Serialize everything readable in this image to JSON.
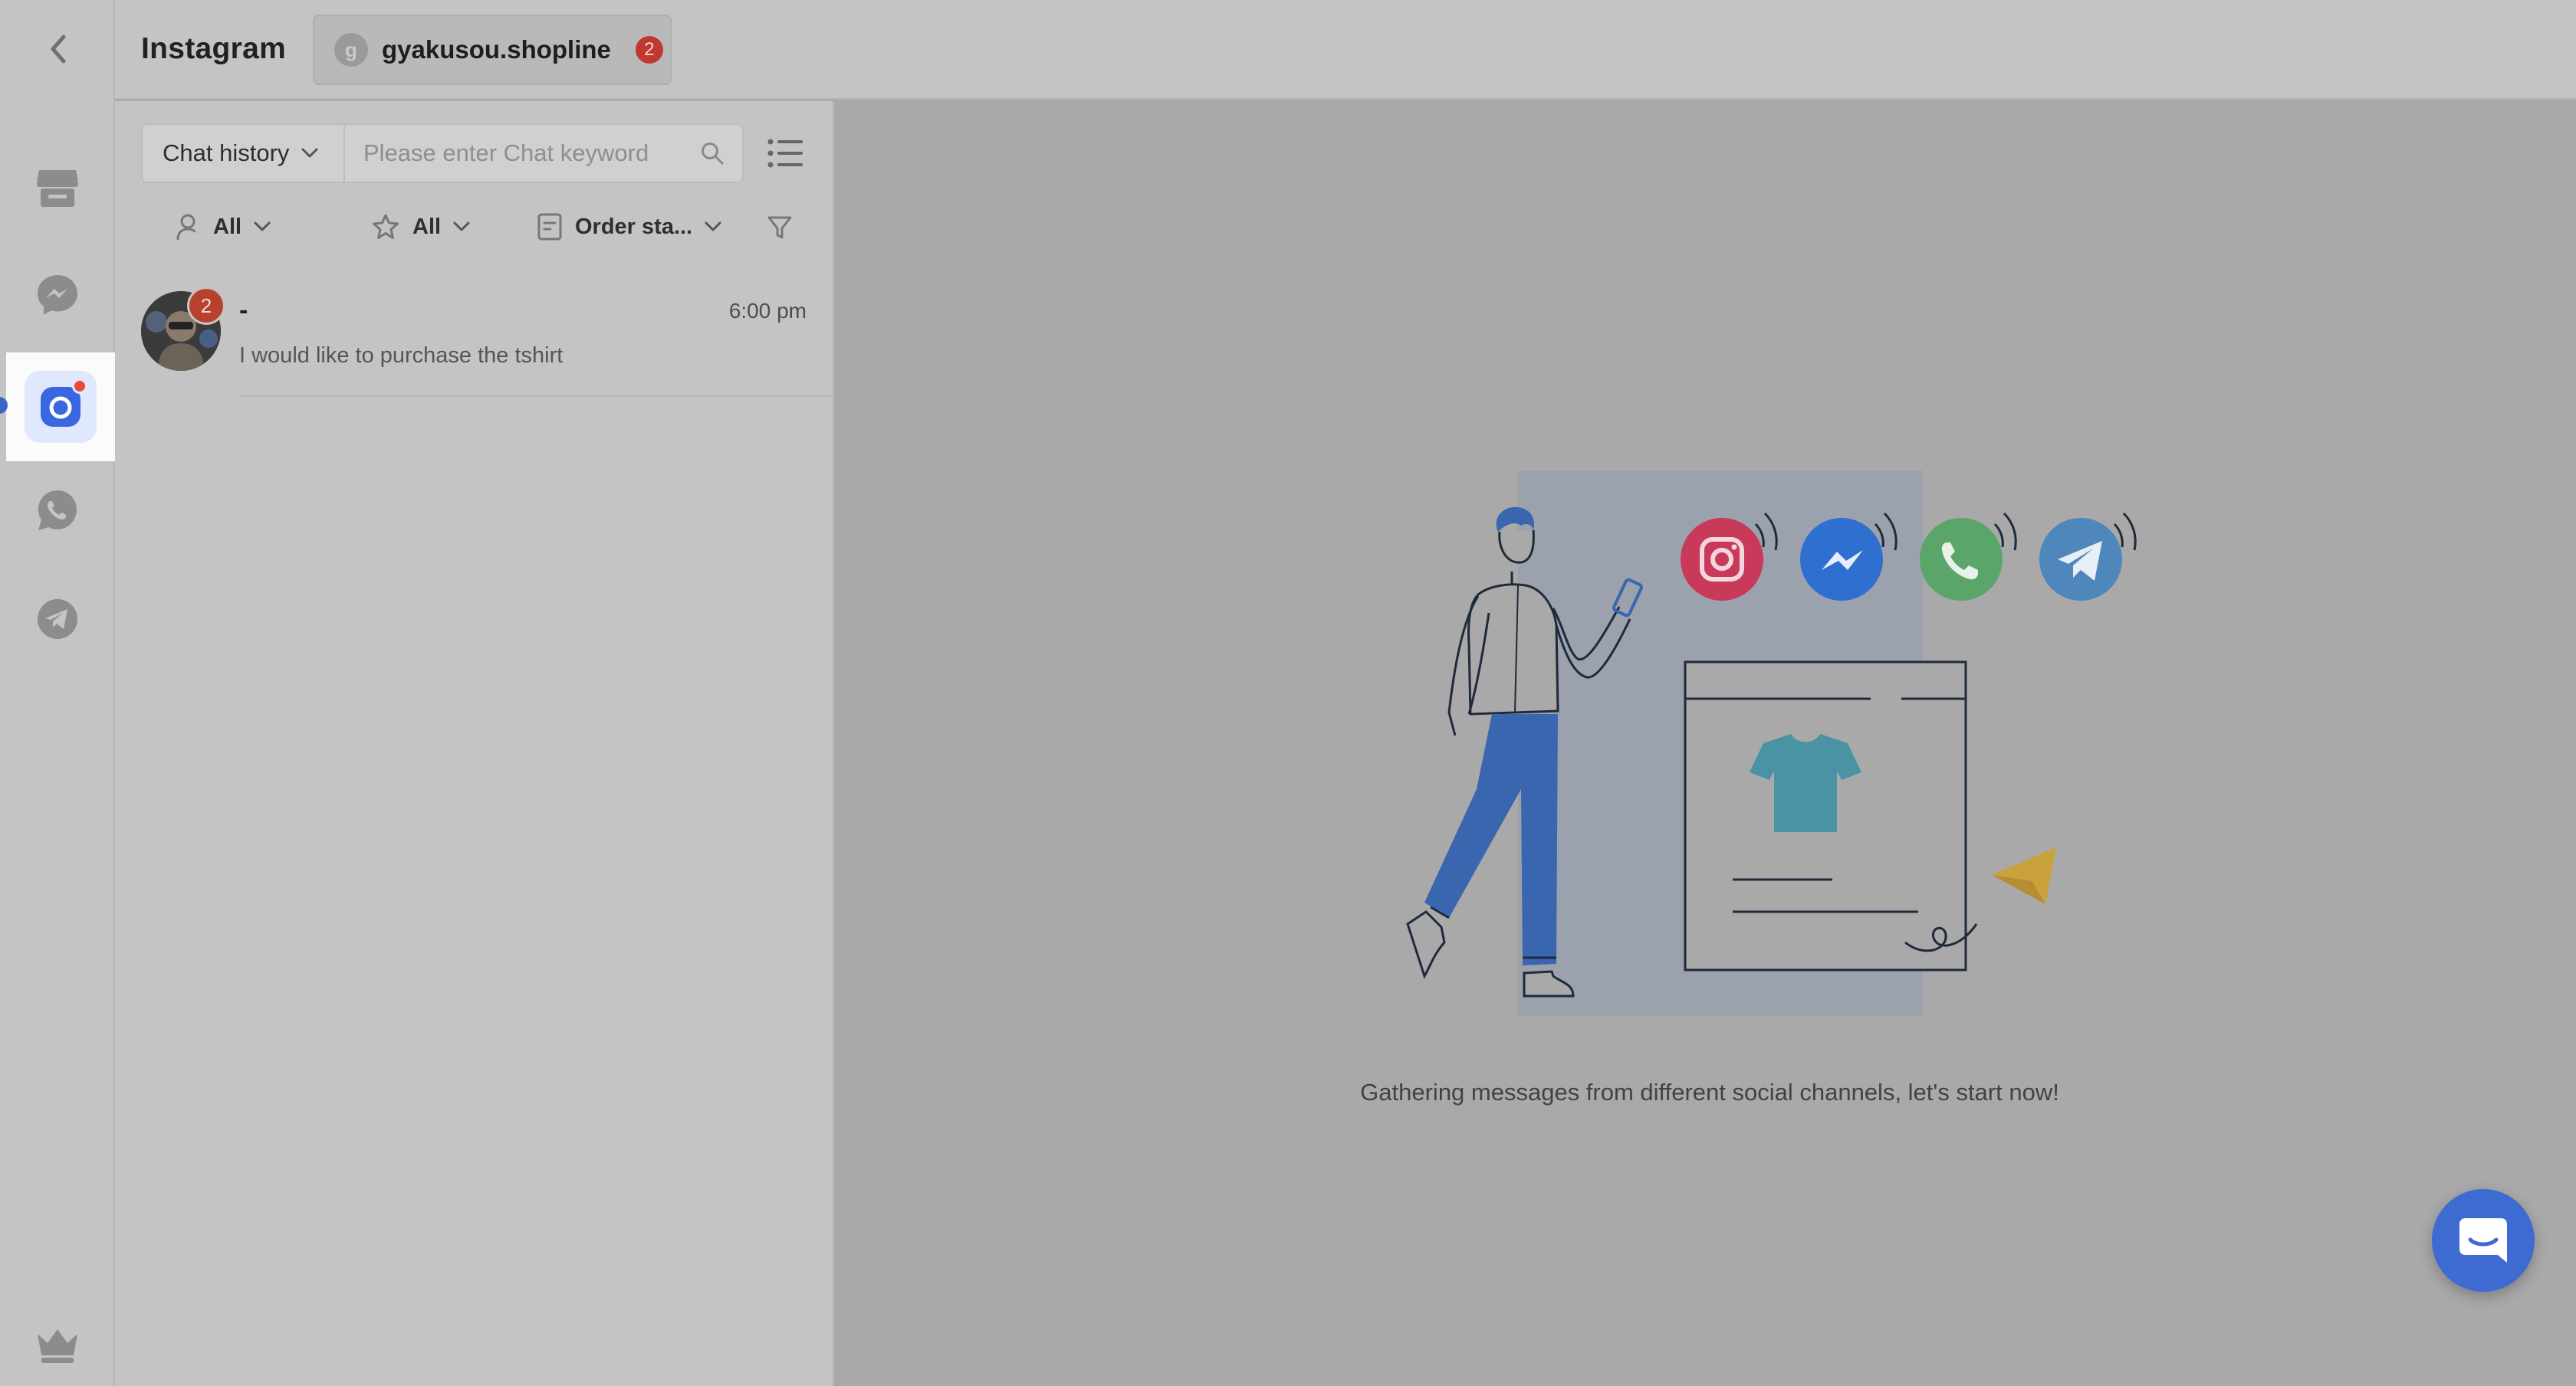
{
  "app": {
    "title": "Instagram"
  },
  "account_tab": {
    "avatar_initial": "g",
    "name": "gyakusou.shopline",
    "unread": "2"
  },
  "rail": {
    "items": [
      {
        "name": "store",
        "icon": "store-icon"
      },
      {
        "name": "messenger",
        "icon": "messenger-icon"
      },
      {
        "name": "instagram",
        "icon": "instagram-icon",
        "active": true
      },
      {
        "name": "whatsapp",
        "icon": "whatsapp-icon"
      },
      {
        "name": "telegram",
        "icon": "telegram-icon"
      }
    ],
    "bottom_icon": "crown-icon"
  },
  "search": {
    "type_label": "Chat history",
    "placeholder": "Please enter Chat keyword",
    "value": ""
  },
  "filters": {
    "assignee": "All",
    "star": "All",
    "order_status": "Order sta..."
  },
  "conversations": [
    {
      "name": "-",
      "time": "6:00 pm",
      "preview": "I would like to purchase the tshirt",
      "unread": "2"
    }
  ],
  "empty_state": {
    "message": "Gathering messages from different social channels, let's start now!"
  },
  "colors": {
    "accent": "#3d6bd1",
    "instagram": "#c8395a",
    "messenger": "#2f6fcf",
    "whatsapp": "#5aa56a",
    "telegram": "#4f86bb",
    "badge": "#c0382f"
  }
}
